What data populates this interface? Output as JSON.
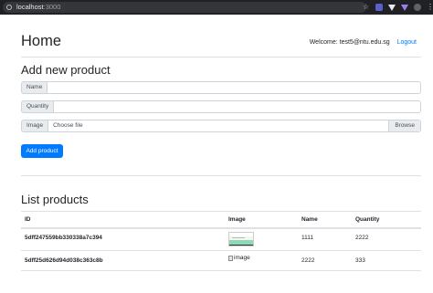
{
  "browser": {
    "url_host": "localhost",
    "url_port": ":3000"
  },
  "header": {
    "title": "Home",
    "welcome": "Welcome: test5@ntu.edu.sg",
    "logout": "Logout"
  },
  "add_form": {
    "title": "Add new product",
    "name_label": "Name",
    "name_value": "",
    "quantity_label": "Quantity",
    "quantity_value": "",
    "image_label": "Image",
    "file_placeholder": "Choose file",
    "browse_label": "Browse",
    "submit_label": "Add product"
  },
  "products": {
    "title": "List products",
    "columns": [
      "ID",
      "Image",
      "Name",
      "Quantity"
    ],
    "rows": [
      {
        "id": "5dff247559bb330338a7c394",
        "image": "thumbnail",
        "name": "1111",
        "quantity": "2222"
      },
      {
        "id": "5dff25d626d94d038c363c8b",
        "image": "image",
        "name": "2222",
        "quantity": "333"
      }
    ]
  },
  "icons": {
    "info": "info-icon",
    "star": "bookmark-star-icon",
    "extensions": [
      "extension-icon",
      "vuetify-icon",
      "triangle-extension-icon",
      "profile-icon"
    ],
    "menu": "kebab-menu-icon"
  },
  "colors": {
    "primary": "#007bff",
    "border": "#dee2e6",
    "chrome": "#202124"
  }
}
